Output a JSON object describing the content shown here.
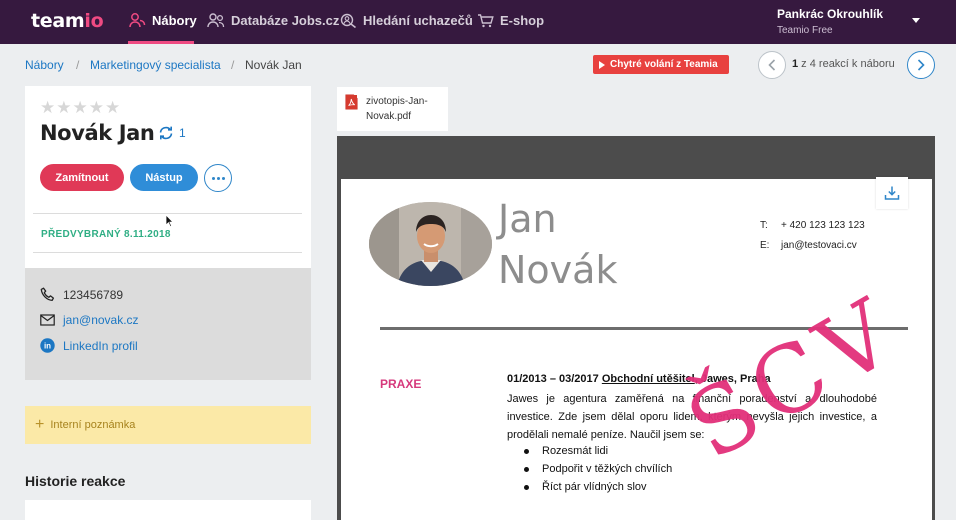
{
  "brand": {
    "logo_main": "team",
    "logo_accent": "io",
    "accent_color": "#ef4a82",
    "nav_bg": "#36193f"
  },
  "nav": {
    "items": [
      {
        "label": "Nábory",
        "icon": "people-icon",
        "active": true
      },
      {
        "label": "Databáze Jobs.cz",
        "icon": "database-people-icon",
        "active": false
      },
      {
        "label": "Hledání uchazečů",
        "icon": "search-people-icon",
        "active": false
      },
      {
        "label": "E-shop",
        "icon": "cart-icon",
        "active": false
      }
    ]
  },
  "user": {
    "name": "Pankrác Okrouhlík",
    "plan": "Teamio Free"
  },
  "breadcrumb": [
    "Nábory",
    "Marketingový specialista",
    "Novák Jan"
  ],
  "smart_call": {
    "label": "Chytré volání z Teamia",
    "color": "#e8413f"
  },
  "pager": {
    "current": "1",
    "rest": " z 4 reakcí k náboru"
  },
  "candidate": {
    "rating": 0,
    "rating_max": 5,
    "name": "Novák Jan",
    "reaction_count": "1",
    "reject_label": "Zamítnout",
    "start_label": "Nástup",
    "status": "PŘEDVYBRANÝ 8.11.2018",
    "status_color": "#2fae84"
  },
  "contacts": {
    "phone": "123456789",
    "email": "jan@novak.cz",
    "linkedin": "LinkedIn profil"
  },
  "note": {
    "label": "Interní poznámka"
  },
  "history": {
    "title": "Historie reakce"
  },
  "document": {
    "filename": "zivotopis-Jan-Novak.pdf",
    "cv": {
      "first_name": "Jan",
      "last_name": "Novák",
      "phone_label": "T:",
      "phone": "+ 420 123 123 123",
      "email_label": "E:",
      "email": "jan@testovaci.cv",
      "section": "PRAXE",
      "job_period": "01/2013 – 03/2017",
      "job_title": "Obchodní utěšitel",
      "job_company": ", Jawes, Praha",
      "job_description": "Jawes je agentura zaměřená na finanční poradenství a dlouhodobé investice. Zde jsem dělal oporu lidem, kterým nevyšla jejich investice, a prodělali nemalé peníze. Naučil jsem se:",
      "bullets": [
        "Rozesmát lidi",
        "Podpořit v těžkých chvílích",
        "Říct pár vlídných slov"
      ],
      "watermark": "ŠCV"
    }
  }
}
